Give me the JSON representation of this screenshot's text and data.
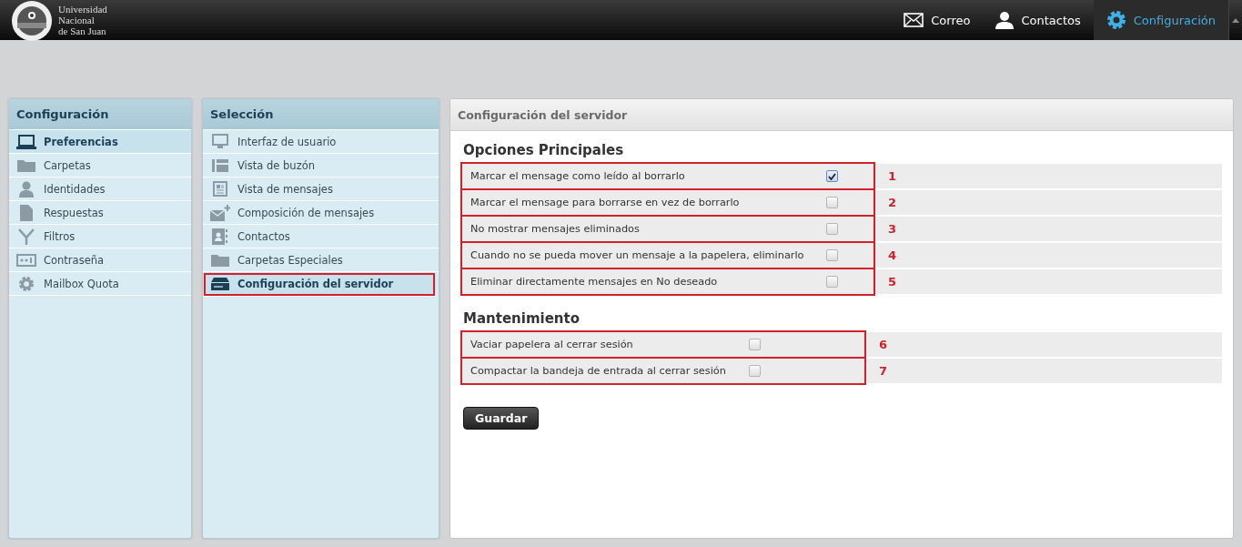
{
  "header": {
    "logo_text": [
      "Universidad",
      "Nacional",
      "de San Juan"
    ],
    "nav": [
      {
        "label": "Correo",
        "selected": false
      },
      {
        "label": "Contactos",
        "selected": false
      },
      {
        "label": "Configuración",
        "selected": true
      }
    ]
  },
  "settings_panel": {
    "title": "Configuración",
    "items": [
      {
        "label": "Preferencias",
        "selected": true
      },
      {
        "label": "Carpetas",
        "selected": false
      },
      {
        "label": "Identidades",
        "selected": false
      },
      {
        "label": "Respuestas",
        "selected": false
      },
      {
        "label": "Filtros",
        "selected": false
      },
      {
        "label": "Contraseña",
        "selected": false
      },
      {
        "label": "Mailbox Quota",
        "selected": false
      }
    ]
  },
  "selection_panel": {
    "title": "Selección",
    "items": [
      {
        "label": "Interfaz de usuario",
        "selected": false,
        "highlighted": false
      },
      {
        "label": "Vista de buzón",
        "selected": false,
        "highlighted": false
      },
      {
        "label": "Vista de mensajes",
        "selected": false,
        "highlighted": false
      },
      {
        "label": "Composición de mensajes",
        "selected": false,
        "highlighted": false
      },
      {
        "label": "Contactos",
        "selected": false,
        "highlighted": false
      },
      {
        "label": "Carpetas Especiales",
        "selected": false,
        "highlighted": false
      },
      {
        "label": "Configuración del servidor",
        "selected": true,
        "highlighted": true
      }
    ]
  },
  "main_panel": {
    "title": "Configuración del servidor",
    "sections": [
      {
        "heading": "Opciones Principales",
        "options": [
          {
            "label": "Marcar el mensage como leído al borrarlo",
            "checked": true,
            "highlighted": true,
            "annotation": "1"
          },
          {
            "label": "Marcar el mensage para borrarse en vez de borrarlo",
            "checked": false,
            "highlighted": true,
            "annotation": "2"
          },
          {
            "label": "No mostrar mensajes eliminados",
            "checked": false,
            "highlighted": true,
            "annotation": "3"
          },
          {
            "label": "Cuando no se pueda mover un mensaje a la papelera, eliminarlo",
            "checked": false,
            "highlighted": true,
            "annotation": "4"
          },
          {
            "label": "Eliminar directamente mensajes en No deseado",
            "checked": false,
            "highlighted": true,
            "annotation": "5"
          }
        ]
      },
      {
        "heading": "Mantenimiento",
        "options": [
          {
            "label": "Vaciar papelera al cerrar sesión",
            "checked": false,
            "highlighted": true,
            "annotation": "6"
          },
          {
            "label": "Compactar la bandeja de entrada al cerrar sesión",
            "checked": false,
            "highlighted": true,
            "annotation": "7"
          }
        ]
      }
    ],
    "save_button": "Guardar"
  }
}
